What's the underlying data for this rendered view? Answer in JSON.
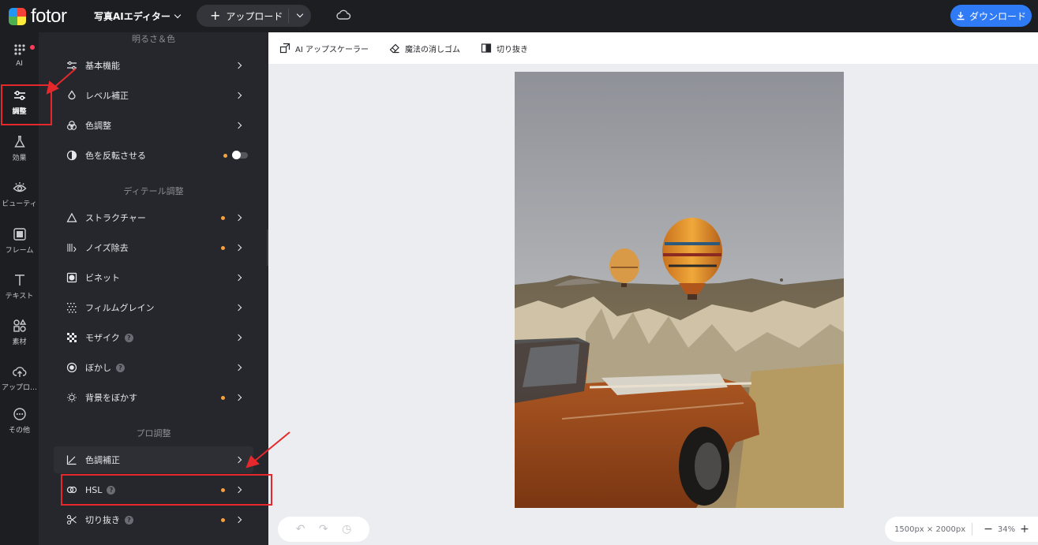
{
  "topbar": {
    "logo_text": "fotor",
    "editor_switch": "写真AIエディター",
    "upload_label": "アップロード",
    "download_label": "ダウンロード"
  },
  "iconbar": {
    "items": [
      {
        "label": "AI",
        "icon": "ai-dots-icon"
      },
      {
        "label": "調整",
        "icon": "sliders-icon"
      },
      {
        "label": "効果",
        "icon": "flask-icon"
      },
      {
        "label": "ビューティ",
        "icon": "eye-icon"
      },
      {
        "label": "フレーム",
        "icon": "frame-icon"
      },
      {
        "label": "テキスト",
        "icon": "text-icon"
      },
      {
        "label": "素材",
        "icon": "elements-icon"
      },
      {
        "label": "アップロ…",
        "icon": "upload-cloud-icon"
      },
      {
        "label": "その他",
        "icon": "more-icon"
      }
    ]
  },
  "panel": {
    "sections": {
      "brightness": "明るさ＆色",
      "detail": "ディテール調整",
      "pro": "プロ調整"
    },
    "rows": {
      "basic": "基本機能",
      "levels": "レベル補正",
      "color": "色調整",
      "invert": "色を反転させる",
      "structure": "ストラクチャー",
      "denoise": "ノイズ除去",
      "vignette": "ビネット",
      "grain": "フィルムグレイン",
      "mosaic": "モザイク",
      "blur": "ぼかし",
      "bg_blur": "背景をぼかす",
      "curves": "色調補正",
      "hsl": "HSL",
      "crop": "切り抜き"
    },
    "help_glyph": "?"
  },
  "toolbar": {
    "upscaler": "AI アップスケーラー",
    "eraser": "魔法の消しゴム",
    "crop": "切り抜き"
  },
  "bottom": {
    "dimensions": "1500px × 2000px",
    "zoom": "34%",
    "zoom_out": "−",
    "zoom_in": "+"
  },
  "colors": {
    "accent_blue": "#2f7bf5",
    "pro_dot": "#f5a340",
    "annotation_red": "#e5282b"
  }
}
